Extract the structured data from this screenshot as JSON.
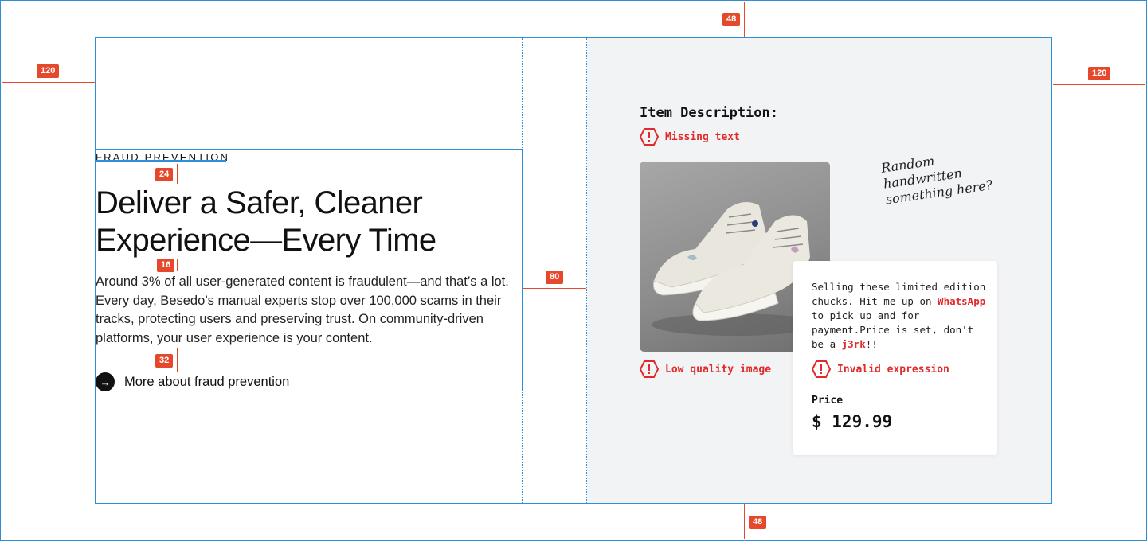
{
  "left": {
    "eyebrow": "FRAUD PREVENTION",
    "headline": "Deliver a Safer, Cleaner Experience—Every Time",
    "body": "Around 3% of all user-generated content is fraudulent—and that’s a lot. Every day, Besedo’s manual experts stop over 100,000 scams in their tracks, protecting users and preserving trust. On community-driven platforms, your user experience is your content.",
    "cta_label": "More about fraud prevention",
    "cta_icon": "arrow-right-icon"
  },
  "right": {
    "item_title": "Item Description:",
    "warnings": {
      "missing_text": "Missing text",
      "low_quality_image": "Low quality image",
      "invalid_expression": "Invalid expression"
    },
    "handwritten_note": "Random handwritten something here?",
    "card": {
      "desc_part1": "Selling these limited edition chucks. Hit me up on ",
      "desc_flag1": "WhatsApp",
      "desc_part2": " to pick up and for payment.Price is set, don't be a ",
      "desc_flag2": "j3rk",
      "desc_part3": "!!",
      "price_label": "Price",
      "price_value": "$ 129.99"
    }
  },
  "spec_annotations": {
    "margin_left": "120",
    "margin_right": "120",
    "margin_top": "48",
    "margin_bottom": "48",
    "eyebrow_gap": "24",
    "headline_gap": "16",
    "body_gap": "32",
    "column_gap": "80"
  },
  "colors": {
    "accent_warning": "#e12a2a",
    "spec_badge": "#e5482a",
    "guide_line": "#2d8fd6",
    "panel_bg": "#f2f3f4"
  }
}
